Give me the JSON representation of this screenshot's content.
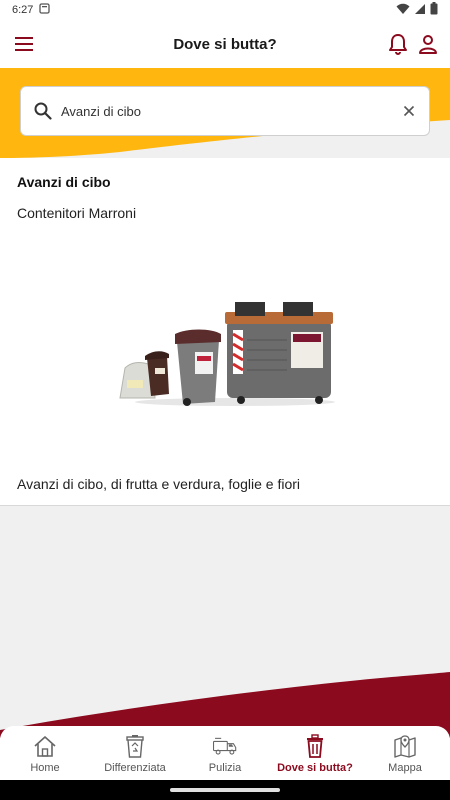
{
  "status_bar": {
    "time": "6:27"
  },
  "app_bar": {
    "title": "Dove si butta?"
  },
  "search": {
    "value": "Avanzi di cibo",
    "placeholder": ""
  },
  "result": {
    "title": "Avanzi di cibo",
    "container": "Contenitori Marroni",
    "description": "Avanzi di cibo, di frutta e verdura, foglie e fiori"
  },
  "bottom_nav": {
    "items": [
      {
        "label": "Home",
        "icon": "home-icon",
        "active": false
      },
      {
        "label": "Differenziata",
        "icon": "recycle-bin-icon",
        "active": false
      },
      {
        "label": "Pulizia",
        "icon": "street-sweeper-icon",
        "active": false
      },
      {
        "label": "Dove si butta?",
        "icon": "trash-icon",
        "active": true
      },
      {
        "label": "Mappa",
        "icon": "map-pin-icon",
        "active": false
      }
    ]
  },
  "colors": {
    "brand": "#8b0a1e",
    "accent_yellow": "#ffb70f",
    "background": "#f0f0f0"
  }
}
